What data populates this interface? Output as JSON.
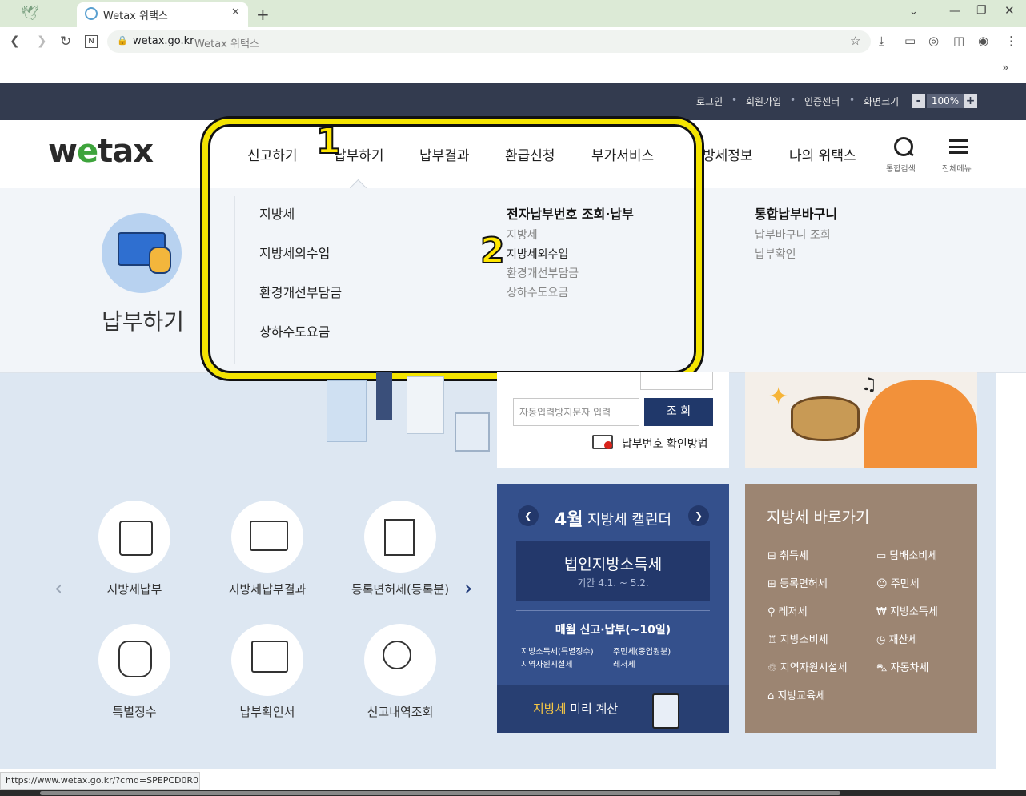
{
  "browser": {
    "tab_title": "Wetax 위택스",
    "new_tab": "+",
    "url_host": "wetax.go.kr",
    "url_title": "Wetax 위택스",
    "status_url": "https://www.wetax.go.kr/?cmd=SPEPCD0R0"
  },
  "util": {
    "login": "로그인",
    "signup": "회원가입",
    "cert": "인증센터",
    "screen_size": "화면크기",
    "minus": "-",
    "zoom": "100%",
    "plus": "+"
  },
  "gnb": {
    "report": "신고하기",
    "pay": "납부하기",
    "result": "납부결과",
    "refund": "환급신청",
    "extra": "부가서비스",
    "local_tax_info": "방세정보",
    "my_wetax": "나의 위택스",
    "search_label": "통합검색",
    "menu_label": "전체메뉴"
  },
  "mega": {
    "title": "납부하기",
    "col1": [
      "지방세",
      "지방세외수입",
      "환경개선부담금",
      "상하수도요금"
    ],
    "col2_heading": "전자납부번호 조회·납부",
    "col2": [
      "지방세",
      "지방세외수입",
      "환경개선부담금",
      "상하수도요금"
    ],
    "col3_heading": "통합납부바구니",
    "col3": [
      "납부바구니 조회",
      "납부확인"
    ]
  },
  "annotations": {
    "one": "1",
    "two": "2"
  },
  "lookup": {
    "captcha_placeholder": "자동입력방지문자 입력",
    "search_btn": "조 회",
    "howto": "납부번호 확인방법"
  },
  "calendar": {
    "month": "4월",
    "title": "지방세 캘린더",
    "tax_name": "법인지방소득세",
    "period": "기간 4.1. ~ 5.2.",
    "monthly": "매월 신고·납부(~10일)",
    "items": [
      "지방소득세(특별징수)",
      "주민세(종업원분)",
      "지역자원시설세",
      "레저세"
    ],
    "calc_highlight": "지방세",
    "calc_rest": " 미리 계산"
  },
  "shortcut": {
    "title": "지방세 바로가기",
    "left": [
      "취득세",
      "등록면허세",
      "레저세",
      "지방소비세",
      "지역자원시설세",
      "지방교육세"
    ],
    "right": [
      "담배소비세",
      "주민세",
      "지방소득세",
      "재산세",
      "자동차세"
    ]
  },
  "services": [
    "지방세납부",
    "지방세납부결과",
    "등록면허세(등록분)",
    "특별징수",
    "납부확인서",
    "신고내역조회"
  ],
  "colors": {
    "topbar": "#333b4f",
    "highlight": "#f4e400",
    "calendar": "#34508c",
    "shortcut": "#9c8572",
    "logo_e": "#3ea43c"
  }
}
